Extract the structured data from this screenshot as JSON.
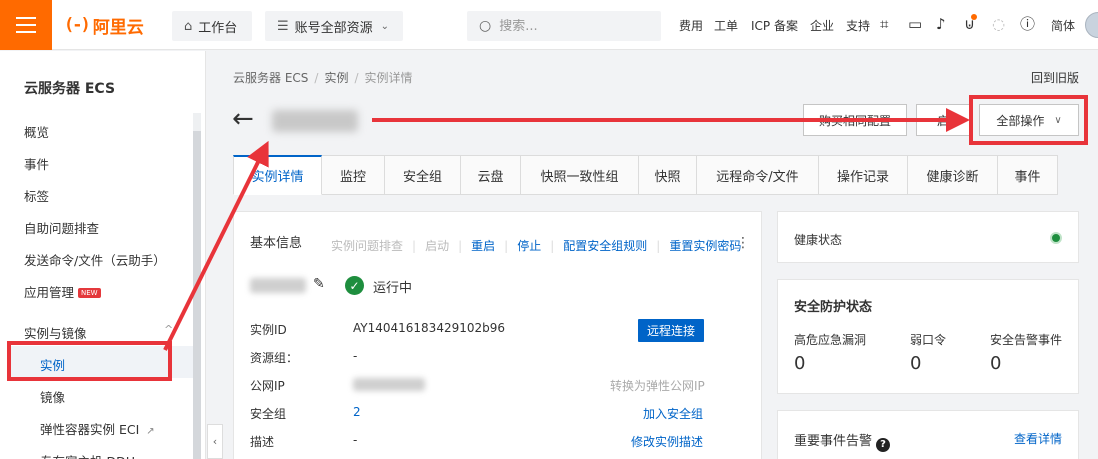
{
  "topbar": {
    "logo_mark": "(-)",
    "logo_text": "阿里云",
    "workbench": "工作台",
    "resources": "账号全部资源",
    "search_placeholder": "搜索...",
    "links": [
      "费用",
      "工单",
      "ICP 备案",
      "企业",
      "支持"
    ],
    "language": "简体",
    "accent_color": "#ff6a00"
  },
  "sidebar": {
    "title": "云服务器 ECS",
    "items": [
      "概览",
      "事件",
      "标签",
      "自助问题排查",
      "发送命令/文件（云助手）",
      "应用管理"
    ],
    "new_badge": "NEW",
    "group": "实例与镜像",
    "sub_items": [
      "实例",
      "镜像",
      "弹性容器实例 ECI",
      "专有宿主机 DDH"
    ]
  },
  "breadcrumb": {
    "items": [
      "云服务器 ECS",
      "实例",
      "实例详情"
    ],
    "back_old": "回到旧版"
  },
  "header": {
    "buttons": [
      "购买相同配置",
      "启",
      "全部操作"
    ]
  },
  "tabs": [
    "实例详情",
    "监控",
    "安全组",
    "云盘",
    "快照一致性组",
    "快照",
    "远程命令/文件",
    "操作记录",
    "健康诊断",
    "事件"
  ],
  "basic_info": {
    "title": "基本信息",
    "actions_disabled": [
      "实例问题排查",
      "启动"
    ],
    "actions": [
      "重启",
      "停止",
      "配置安全组规则",
      "重置实例密码"
    ],
    "status": "运行中",
    "rows": {
      "instance_id_label": "实例ID",
      "instance_id": "AY140416183429102b96",
      "resource_group_label": "资源组：",
      "resource_group": "-",
      "public_ip_label": "公网IP",
      "security_group_label": "安全组",
      "security_group": "2",
      "description_label": "描述",
      "description": "-"
    },
    "remote_connect": "远程连接",
    "convert_eip": "转换为弹性公网IP",
    "join_sg": "加入安全组",
    "edit_desc": "修改实例描述"
  },
  "health": {
    "label": "健康状态"
  },
  "security": {
    "title": "安全防护状态",
    "items": [
      {
        "label": "高危应急漏洞",
        "value": "0"
      },
      {
        "label": "弱口令",
        "value": "0"
      },
      {
        "label": "安全告警事件",
        "value": "0"
      }
    ]
  },
  "events": {
    "title": "重要事件告警",
    "link": "查看详情"
  }
}
